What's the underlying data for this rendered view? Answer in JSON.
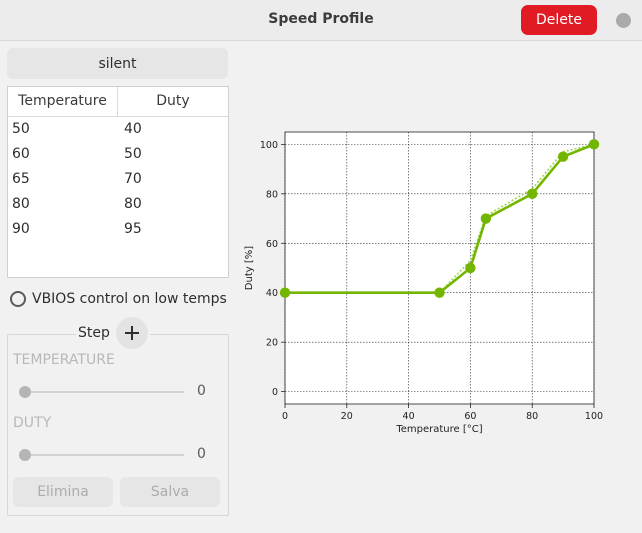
{
  "window": {
    "title": "Speed Profile",
    "delete_label": "Delete"
  },
  "profile": {
    "name": "silent"
  },
  "table": {
    "headers": [
      "Temperature",
      "Duty"
    ],
    "rows": [
      [
        "50",
        "40"
      ],
      [
        "60",
        "50"
      ],
      [
        "65",
        "70"
      ],
      [
        "80",
        "80"
      ],
      [
        "90",
        "95"
      ]
    ]
  },
  "vbios": {
    "label": "VBIOS control on low temps",
    "checked": false
  },
  "step": {
    "label": "Step",
    "temperature_label": "TEMPERATURE",
    "temperature_value": "0",
    "duty_label": "DUTY",
    "duty_value": "0",
    "delete_label": "Elimina",
    "save_label": "Salva"
  },
  "colors": {
    "accent": "#73b600",
    "danger": "#e01b24"
  },
  "icons": [
    "plus-icon",
    "close-icon",
    "radio-icon"
  ],
  "chart_data": {
    "type": "line",
    "xlabel": "Temperature [°C]",
    "ylabel": "Duty [%]",
    "xlim": [
      0,
      100
    ],
    "ylim": [
      -5,
      105
    ],
    "xticks": [
      0,
      20,
      40,
      60,
      80,
      100
    ],
    "yticks": [
      0,
      20,
      40,
      60,
      80,
      100
    ],
    "grid": true,
    "series": [
      {
        "style": "solid",
        "x": [
          0,
          50,
          60,
          65,
          80,
          90,
          100
        ],
        "y": [
          40,
          40,
          50,
          70,
          80,
          95,
          100
        ]
      },
      {
        "style": "dotted",
        "x": [
          0,
          50,
          60,
          65,
          80,
          90,
          100
        ],
        "y": [
          40,
          40,
          53,
          71,
          82,
          97,
          100
        ]
      }
    ]
  }
}
